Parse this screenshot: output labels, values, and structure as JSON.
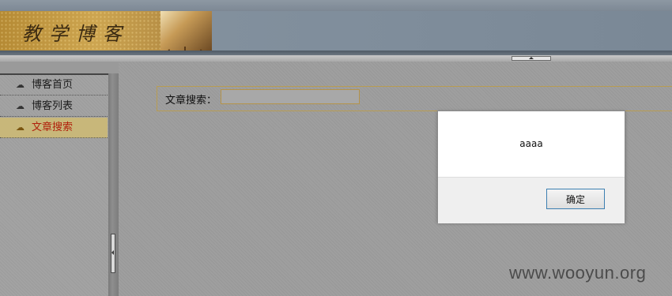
{
  "header": {
    "banner_title": "教学博客"
  },
  "sidebar": {
    "items": [
      {
        "label": "博客首页",
        "icon": "cloud-icon",
        "active": false
      },
      {
        "label": "博客列表",
        "icon": "cloud-icon",
        "active": false
      },
      {
        "label": "文章搜索",
        "icon": "cloud-icon",
        "active": true
      }
    ]
  },
  "search": {
    "label": "文章搜索：",
    "value": ""
  },
  "dialog": {
    "message": "aaaa",
    "ok_label": "确定"
  },
  "watermark": "www.wooyun.org",
  "colors": {
    "active_nav_bg": "#c8b77a",
    "active_nav_text": "#b0200c",
    "banner_gold": "#cda550"
  }
}
